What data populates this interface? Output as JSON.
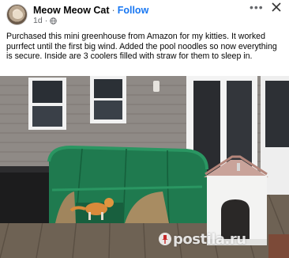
{
  "post": {
    "author": "Meow Meow Cat",
    "separator": "·",
    "follow_label": "Follow",
    "time": "1d",
    "more_icon": "more-options-icon",
    "close_icon": "close-icon",
    "audience_icon": "globe-icon",
    "caption": "Purchased this mini greenhouse from Amazon for my kitties. It worked purrfect until the first big wind. Added the pool noodles so now everything is secure.  Inside are 3 coolers filled with straw for them to sleep in."
  },
  "photo": {
    "watermark": "postila.ru"
  },
  "colors": {
    "follow": "#1877f2",
    "meta": "#65676b",
    "greenhouse": "#1f7a4f",
    "deck": "#6e6254"
  }
}
